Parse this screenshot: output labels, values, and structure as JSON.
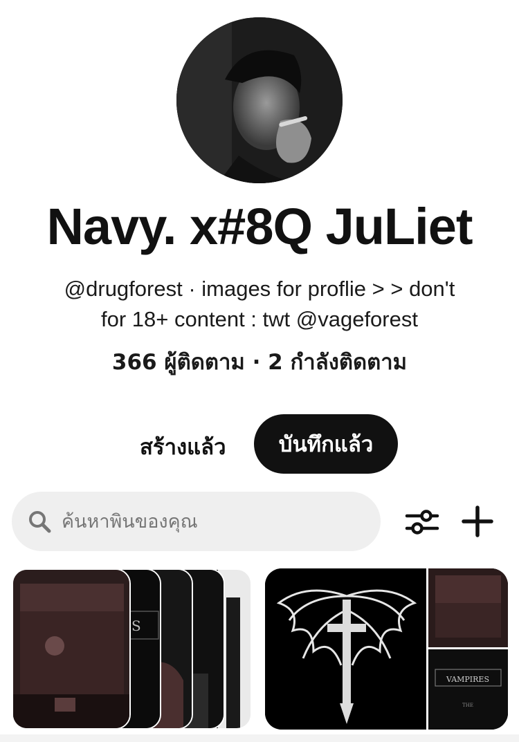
{
  "profile": {
    "display_name": "Navy. x#8Q JuLiet",
    "bio_line1": "@drugforest · images for proflie > > don't",
    "bio_line2": "for 18+ content : twt @vageforest",
    "stats": "366 ผู้ติดตาม · 2 กำลังติดตาม"
  },
  "tabs": {
    "created": "สร้างแล้ว",
    "saved": "บันทึกแล้ว",
    "active": "saved"
  },
  "search": {
    "placeholder": "ค้นหาพินของคุณ"
  },
  "toolbar": {
    "filter_icon": "sliders-icon",
    "add_icon": "plus-icon"
  },
  "boards": [
    {
      "thumbnails": [
        "coffin",
        "vampires-book",
        "dark-cover",
        "dark-cover",
        "dark-cover"
      ]
    },
    {
      "thumbnails": [
        "winged-cross",
        "coffin",
        "vampires-book"
      ],
      "cover_text": "VAMPIRES"
    }
  ],
  "colors": {
    "primary_button": "#111111",
    "search_bg": "#efefef",
    "placeholder": "#767676"
  }
}
